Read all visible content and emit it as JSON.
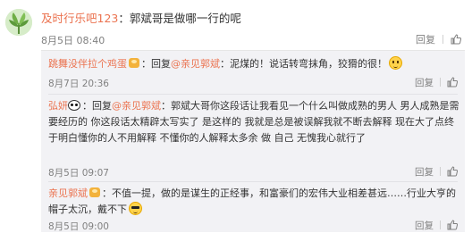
{
  "main_comment": {
    "username": "及时行乐吧123",
    "colon": "：",
    "text": "郭斌哥是做哪一行的呢",
    "time": "8月5日 08:40",
    "reply_label": "回复",
    "like_icon": "thumb-up-icon"
  },
  "replies": [
    {
      "username": "跳舞没伴拉个鸡蛋",
      "reply_word": "：回复",
      "mention": "@亲见郭斌",
      "text_after_mention": "：泥煤的！说话转弯抹角，狡猾的很！",
      "badge_icon": "vip-badge-icon",
      "emoji_icon": "grin-emoji-icon",
      "time": "8月7日 20:36",
      "reply_label": "回复",
      "like_icon": "thumb-up-icon"
    },
    {
      "username": "弘妍",
      "reply_word": "：回复",
      "mention": "@亲见郭斌",
      "text_after_mention": "：郭斌大哥你这段话让我看见一个什么叫做成熟的男人 男人成熟是需要经历的 你这段话太精辟太写实了 是这样的 我就是总是被误解我就不断去解释 现在大了点终于明白懂你的人不用解释 不懂你的人解释太多余 做 自己 无愧我心就行了",
      "avatar_icon": "panda-icon",
      "time": "8月5日 09:07",
      "reply_label": "回复",
      "like_icon": "thumb-up-icon"
    },
    {
      "username": "亲见郭斌",
      "text": "：不值一提，做的是谋生的正经事，和富豪们的宏伟大业相差甚远……行业大亨的帽子太沉，戴不下",
      "badge_icon": "vip-badge-icon",
      "emoji_icon": "sunglasses-emoji-icon",
      "time": "8月5日 09:00",
      "reply_label": "回复",
      "like_icon": "thumb-up-icon"
    }
  ],
  "colors": {
    "username": "#eb7350",
    "text": "#333333",
    "meta": "#808080",
    "reply_bg": "#f2f2f5"
  }
}
